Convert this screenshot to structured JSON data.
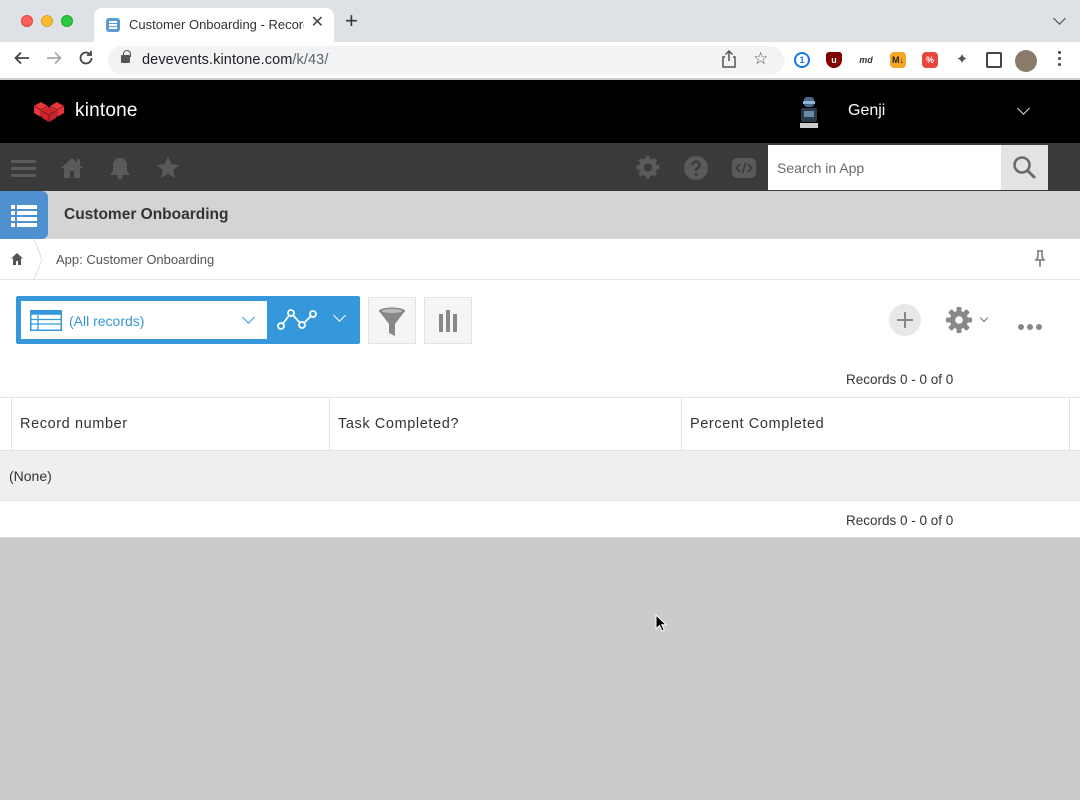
{
  "browser": {
    "tab_title": "Customer Onboarding - Records",
    "url_host": "devevents.kintone.com",
    "url_path": "/k/43/"
  },
  "header": {
    "logo_text": "kintone",
    "username": "Genji"
  },
  "global_nav": {
    "search_placeholder": "Search in App"
  },
  "app": {
    "title": "Customer Onboarding",
    "breadcrumb": "App: Customer Onboarding"
  },
  "view": {
    "selected": "(All records)"
  },
  "records": {
    "count_top": "Records 0 - 0 of 0",
    "count_bottom": "Records 0 - 0 of 0",
    "columns": [
      "Record number",
      "Task Completed?",
      "Percent Completed"
    ],
    "empty_text": "(None)"
  },
  "colors": {
    "accent": "#3498db",
    "header_bg": "#000000",
    "nav_bg": "#3a3a3a",
    "app_icon": "#4f90d0",
    "logo_red": "#e8353b"
  }
}
